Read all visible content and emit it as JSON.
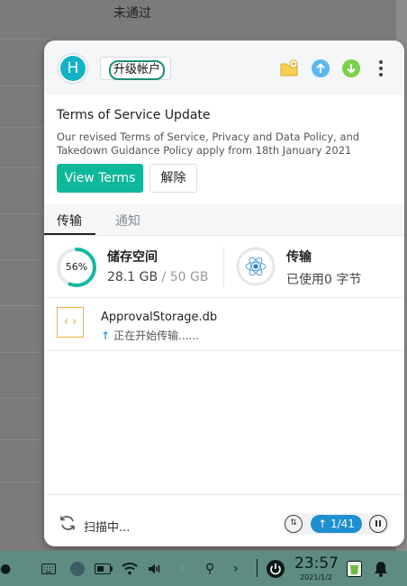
{
  "background": {
    "status_text": "未通过"
  },
  "header": {
    "avatar_letter": "H",
    "upgrade_label": "升级帐户",
    "icons": [
      "new-folder-icon",
      "upload-icon",
      "download-icon",
      "more-icon"
    ]
  },
  "notice": {
    "title": "Terms of Service Update",
    "body": "Our revised Terms of Service, Privacy and Data Policy, and Takedown Guidance Policy apply from 18th January 2021",
    "view_label": "View Terms",
    "dismiss_label": "解除"
  },
  "tabs": [
    {
      "label": "传输",
      "active": true
    },
    {
      "label": "通知",
      "active": false
    }
  ],
  "storage": {
    "title": "储存空间",
    "percent_label": "56%",
    "percent": 56,
    "used": "28.1 GB",
    "separator": "/",
    "total": "50 GB"
  },
  "transfer": {
    "title": "传输",
    "status": "已使用0 字节"
  },
  "file": {
    "name": "ApprovalStorage.db",
    "status": "正在开始传输......",
    "arrow": "↑"
  },
  "footer": {
    "scan_text": "扫描中...",
    "count": "1/41",
    "arrow": "↑"
  },
  "taskbar": {
    "time": "23:57",
    "date": "2021/1/2"
  },
  "colors": {
    "accent": "#0eb89a",
    "ring": "#12b9a0",
    "upload_blue": "#5bb8ee",
    "download_green": "#7ad04a",
    "count_blue": "#1e8fd0"
  }
}
